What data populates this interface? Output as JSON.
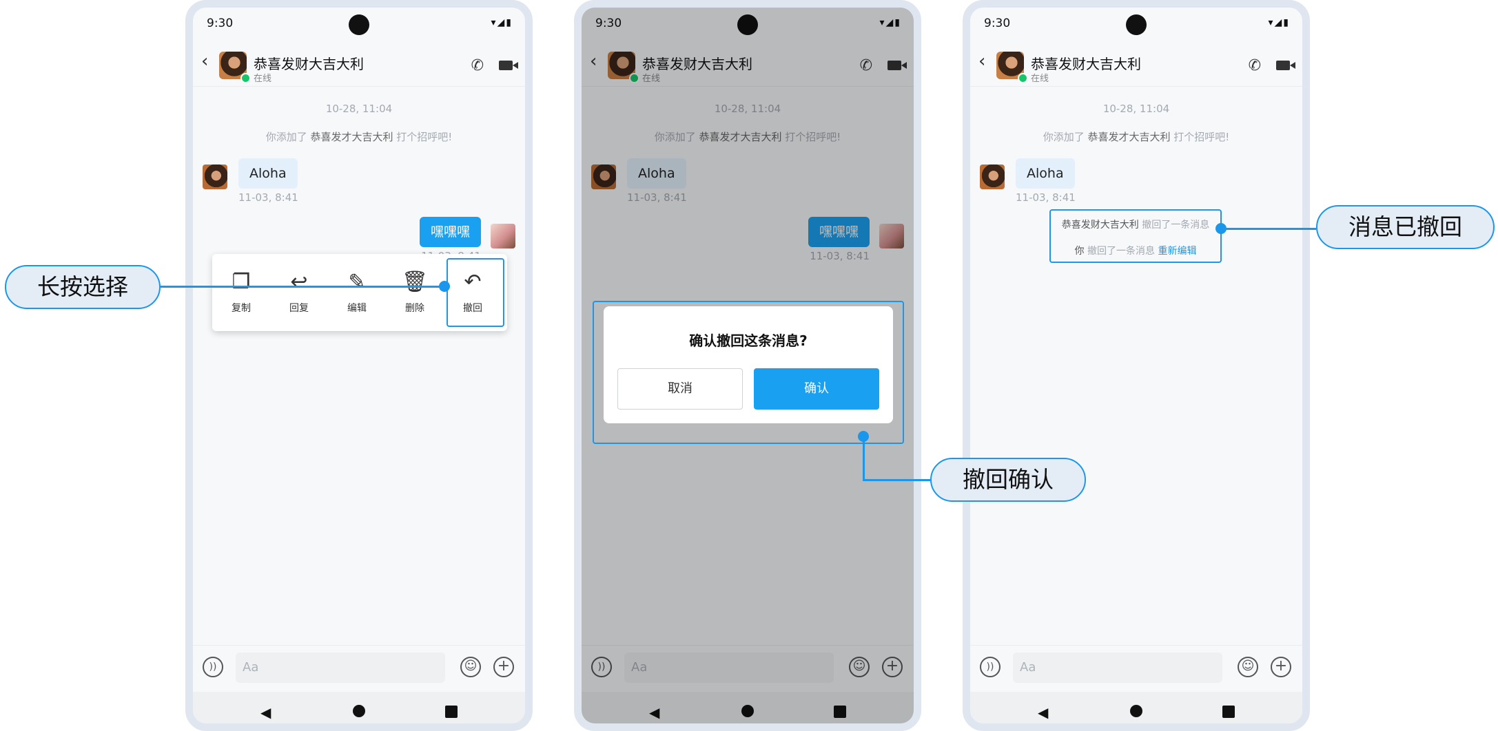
{
  "status": {
    "time": "9:30"
  },
  "chat": {
    "name": "恭喜发财大吉大利",
    "presence": "在线",
    "date": "10-28, 11:04",
    "system_pre": "你添加了",
    "system_name": "恭喜发才大吉大利",
    "system_post": "打个招呼吧!",
    "incoming_text": "Aloha",
    "incoming_time": "11-03, 8:41",
    "outgoing_text": "嘿嘿嘿",
    "outgoing_time": "11-03, 8:41",
    "input_placeholder": "Aa"
  },
  "menu": {
    "items": [
      {
        "label": "复制",
        "icon": "copy-icon"
      },
      {
        "label": "回复",
        "icon": "reply-icon"
      },
      {
        "label": "编辑",
        "icon": "edit-icon"
      },
      {
        "label": "删除",
        "icon": "trash-icon"
      },
      {
        "label": "撤回",
        "icon": "undo-icon"
      }
    ]
  },
  "dialog": {
    "title": "确认撤回这条消息?",
    "cancel": "取消",
    "confirm": "确认"
  },
  "recalled": {
    "name": "恭喜发财大吉大利",
    "text1": "撤回了一条消息",
    "you": "你",
    "text2": "撤回了一条消息",
    "reedit": "重新编辑"
  },
  "callouts": {
    "long_press": "长按选择",
    "confirm": "撤回确认",
    "recalled": "消息已撤回"
  },
  "colors": {
    "accent": "#1a97ec",
    "online": "#18c66a",
    "bubble_out": "#1aa0f0"
  }
}
